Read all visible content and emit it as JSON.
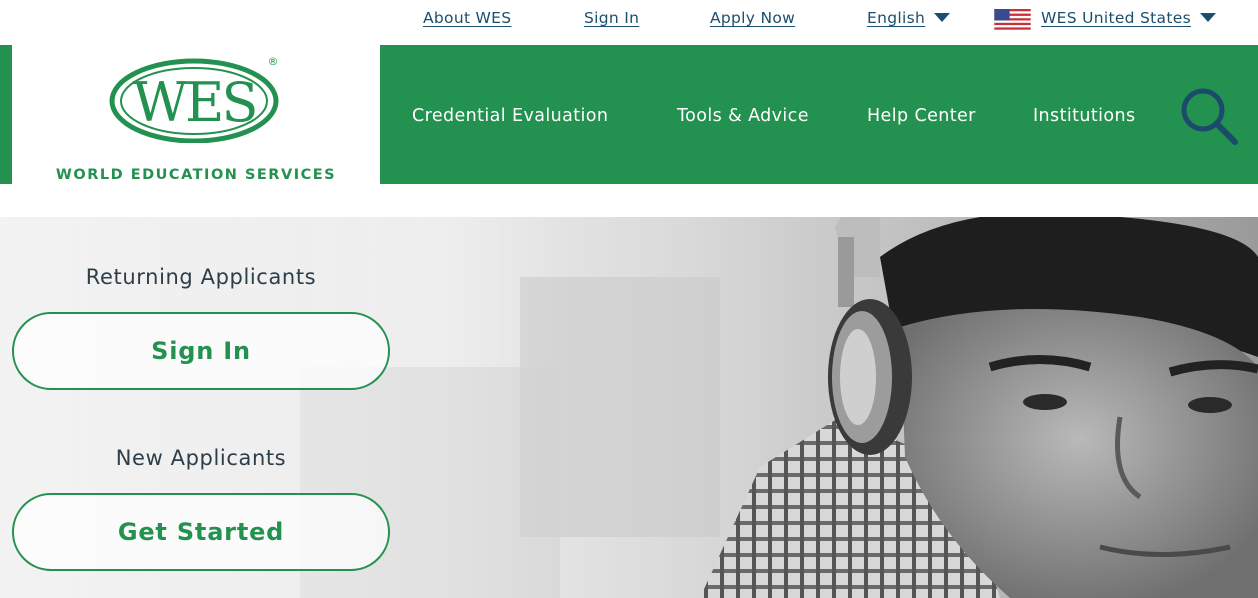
{
  "utility_nav": {
    "about": "About WES",
    "sign_in": "Sign In",
    "apply_now": "Apply Now",
    "language": "English",
    "region": "WES United States"
  },
  "logo": {
    "mark_text": "WES",
    "registered_symbol": "®",
    "caption": "WORLD EDUCATION SERVICES"
  },
  "main_nav": {
    "items": [
      "Credential Evaluation",
      "Tools & Advice",
      "Help Center",
      "Institutions"
    ]
  },
  "hero": {
    "returning_heading": "Returning Applicants",
    "sign_in_button": "Sign In",
    "new_heading": "New Applicants",
    "get_started_button": "Get Started"
  },
  "icons": {
    "search": "search-icon",
    "language_caret": "chevron-down-icon",
    "region_caret": "chevron-down-icon",
    "flag": "us-flag-icon"
  },
  "colors": {
    "brand_green": "#23914f",
    "link_navy": "#1c4f6e",
    "search_icon_navy": "#1b4a6b",
    "heading_text": "#2d3e4b"
  }
}
